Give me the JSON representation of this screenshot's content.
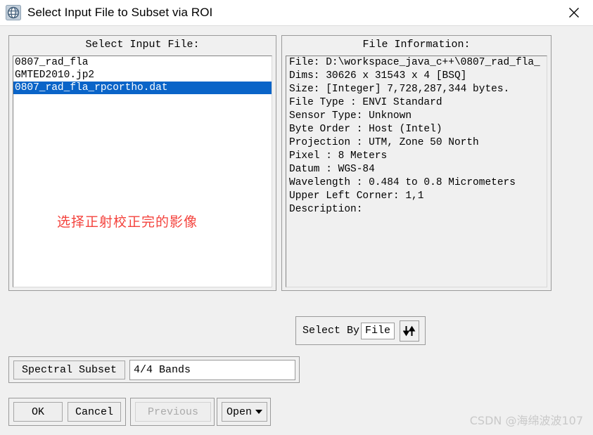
{
  "window": {
    "title": "Select Input File to Subset via ROI",
    "icon": "envi-globe-icon",
    "close_label": "close-icon"
  },
  "left_panel": {
    "heading": "Select Input File:",
    "files": [
      {
        "name": "0807_rad_fla",
        "selected": false
      },
      {
        "name": "GMTED2010.jp2",
        "selected": false
      },
      {
        "name": "0807_rad_fla_rpcortho.dat",
        "selected": true
      }
    ],
    "annotation": "选择正射校正完的影像"
  },
  "right_panel": {
    "heading": "File Information:",
    "lines": [
      "File: D:\\workspace_java_c++\\0807_rad_fla_",
      "Dims: 30626 x 31543 x 4 [BSQ]",
      "Size: [Integer] 7,728,287,344 bytes.",
      "File Type  : ENVI Standard",
      "Sensor Type: Unknown",
      "Byte Order : Host (Intel)",
      "Projection : UTM, Zone 50 North",
      "  Pixel    : 8 Meters",
      "  Datum    : WGS-84",
      "Wavelength : 0.484 to 0.8 Micrometers",
      "Upper Left Corner: 1,1",
      "Description:"
    ]
  },
  "select_by": {
    "label": "Select By",
    "value": "File",
    "toggle_icon": "updown-arrows-icon"
  },
  "spectral": {
    "button_label": "Spectral Subset",
    "bands_value": "4/4 Bands"
  },
  "buttons": {
    "ok": "OK",
    "cancel": "Cancel",
    "previous": "Previous",
    "open": "Open"
  },
  "watermark": "CSDN @海绵波波107",
  "colors": {
    "selection_blue": "#0a64c8",
    "annotation_red": "#f4423c",
    "dialog_bg": "#f0f0f0"
  }
}
